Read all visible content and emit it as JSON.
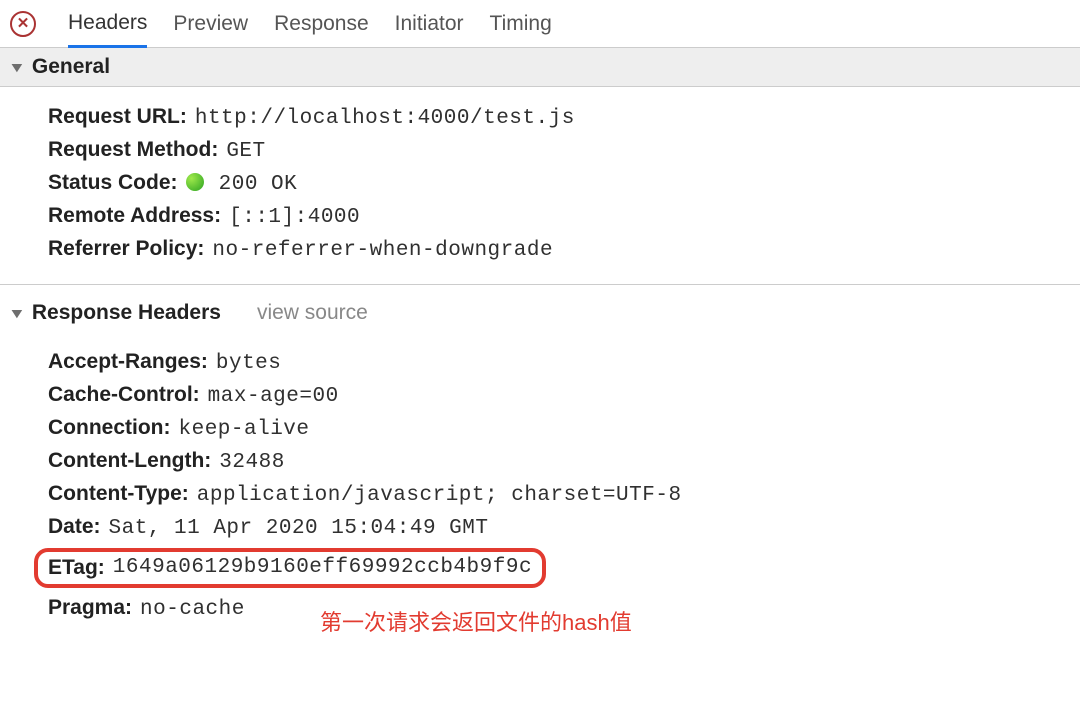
{
  "tabs": [
    "Headers",
    "Preview",
    "Response",
    "Initiator",
    "Timing"
  ],
  "general": {
    "title": "General",
    "requestUrl": {
      "label": "Request URL:",
      "value": "http://localhost:4000/test.js"
    },
    "requestMethod": {
      "label": "Request Method:",
      "value": "GET"
    },
    "statusCode": {
      "label": "Status Code:",
      "value": "200 OK"
    },
    "remoteAddress": {
      "label": "Remote Address:",
      "value": "[::1]:4000"
    },
    "referrerPolicy": {
      "label": "Referrer Policy:",
      "value": "no-referrer-when-downgrade"
    }
  },
  "responseHeaders": {
    "title": "Response Headers",
    "viewSource": "view source",
    "items": {
      "acceptRanges": {
        "label": "Accept-Ranges:",
        "value": "bytes"
      },
      "cacheControl": {
        "label": "Cache-Control:",
        "value": "max-age=00"
      },
      "connection": {
        "label": "Connection:",
        "value": "keep-alive"
      },
      "contentLength": {
        "label": "Content-Length:",
        "value": "32488"
      },
      "contentType": {
        "label": "Content-Type:",
        "value": "application/javascript; charset=UTF-8"
      },
      "date": {
        "label": "Date:",
        "value": "Sat, 11 Apr 2020 15:04:49 GMT"
      },
      "etag": {
        "label": "ETag:",
        "value": "1649a06129b9160eff69992ccb4b9f9c"
      },
      "pragma": {
        "label": "Pragma:",
        "value": "no-cache"
      }
    }
  },
  "annotation": "第一次请求会返回文件的hash值",
  "colors": {
    "highlight": "#e23b30",
    "tabActive": "#1a73e8",
    "statusGreen": "#2ba321"
  }
}
